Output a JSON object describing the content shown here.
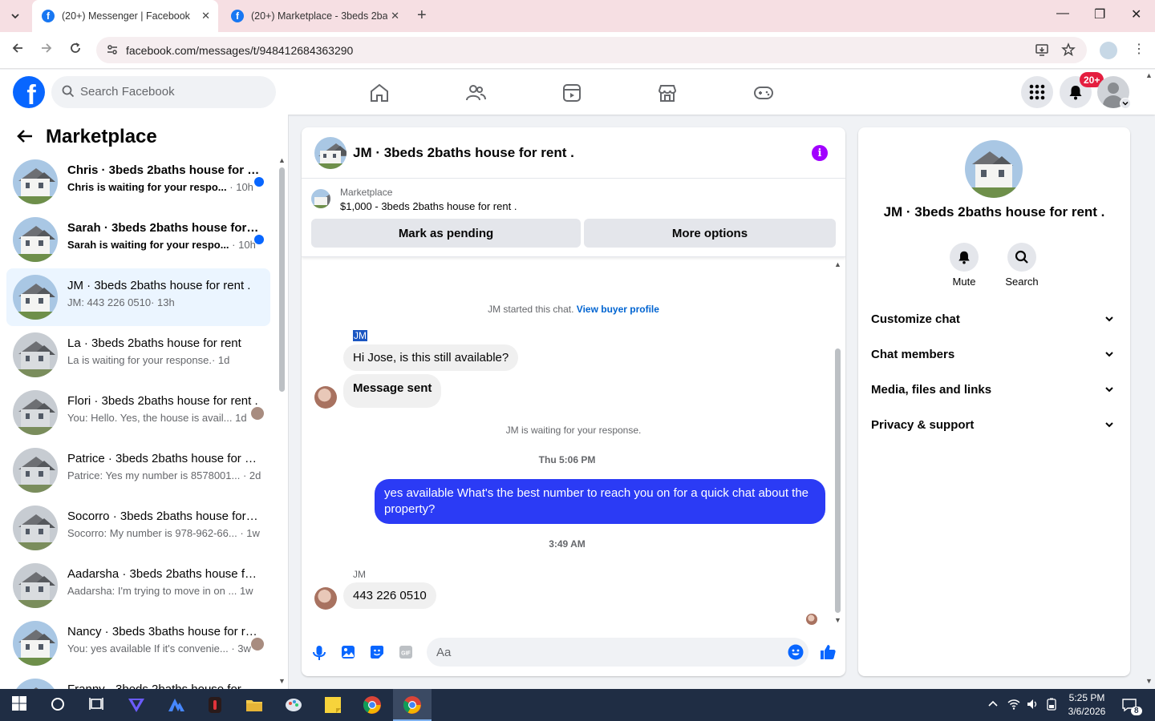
{
  "browser": {
    "tabs": [
      {
        "title": "(20+) Messenger | Facebook",
        "active": true
      },
      {
        "title": "(20+) Marketplace - 3beds 2baths",
        "active": false
      }
    ],
    "url": "facebook.com/messages/t/948412684363290"
  },
  "header": {
    "search_placeholder": "Search Facebook",
    "notification_count": "20+"
  },
  "sidebar": {
    "title": "Marketplace",
    "conversations": [
      {
        "name": "Chris · 3beds 2baths house for rent .",
        "preview": "Chris is waiting for your respo...",
        "time": "· 10h",
        "unread": true
      },
      {
        "name": "Sarah · 3beds 2baths house for rent .",
        "preview": "Sarah is waiting for your respo...",
        "time": "· 10h",
        "unread": true
      },
      {
        "name": "JM · 3beds 2baths house for rent .",
        "preview": "JM: 443 226 0510",
        "time": "· 13h",
        "unread": false
      },
      {
        "name": "La · 3beds 2baths house for rent",
        "preview": "La is waiting for your response.",
        "time": "· 1d",
        "unread": false
      },
      {
        "name": "Flori · 3beds 2baths house for rent .",
        "preview": "You: Hello. Yes, the house is avail...",
        "time": "1d",
        "unread": false
      },
      {
        "name": "Patrice · 3beds 2baths house for rent .",
        "preview": "Patrice: Yes my number is 8578001...",
        "time": "· 2d",
        "unread": false
      },
      {
        "name": "Socorro · 3beds 2baths house for rent .",
        "preview": "Socorro: My number is 978-962-66...",
        "time": "· 1w",
        "unread": false
      },
      {
        "name": "Aadarsha · 3beds 2baths house for rent .",
        "preview": "Aadarsha: I'm trying to move in on ...",
        "time": "1w",
        "unread": false
      },
      {
        "name": "Nancy · 3beds 3baths house for rent .",
        "preview": "You: yes available If it's convenie...",
        "time": "· 3w",
        "unread": false
      },
      {
        "name": "Franny · 3beds 2baths house for rent .",
        "preview": "",
        "time": "",
        "unread": false
      }
    ]
  },
  "chat": {
    "title": "JM · 3beds 2baths house for rent .",
    "marketplace_label": "Marketplace",
    "listing": "$1,000 - 3beds 2baths house for rent .",
    "mark_pending": "Mark as pending",
    "more_options": "More options",
    "started_text": "JM started this chat.",
    "view_buyer": "View buyer profile",
    "sender_1": "JM",
    "msg_1": "Hi Jose, is this still available?",
    "msg_2": "Message sent",
    "waiting": "JM is waiting for your response.",
    "time_1": "Thu 5:06 PM",
    "msg_out": "yes available What's the best number to reach you on for a quick chat about the property?",
    "time_2": "3:49 AM",
    "sender_2": "JM",
    "msg_3": "443 226 0510",
    "composer_placeholder": "Aa"
  },
  "details": {
    "name": "JM · 3beds 2baths house for rent .",
    "mute": "Mute",
    "search": "Search",
    "rows": [
      "Customize chat",
      "Chat members",
      "Media, files and links",
      "Privacy & support"
    ]
  },
  "taskbar": {
    "time": "5:25 PM",
    "date": "3/6/2026",
    "notif_count": "8"
  },
  "colors": {
    "fb_blue": "#0866ff",
    "outgoing_bubble": "#2b3bf5",
    "info_purple": "#a100ff",
    "badge_red": "#e41e3f"
  }
}
